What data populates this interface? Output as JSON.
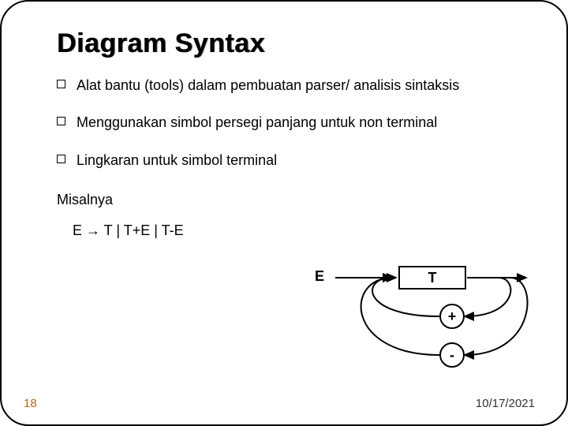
{
  "title": "Diagram Syntax",
  "bullets": [
    "Alat bantu (tools) dalam pembuatan parser/ analisis sintaksis",
    "Menggunakan simbol persegi panjang untuk non terminal",
    "Lingkaran untuk simbol terminal"
  ],
  "example_label": "Misalnya",
  "grammar_rule": "E → T | T+E | T-E",
  "diagram": {
    "start_label": "E",
    "nonterminal": "T",
    "term_plus": "+",
    "term_minus": "-"
  },
  "page_number": "18",
  "date": "10/17/2021"
}
